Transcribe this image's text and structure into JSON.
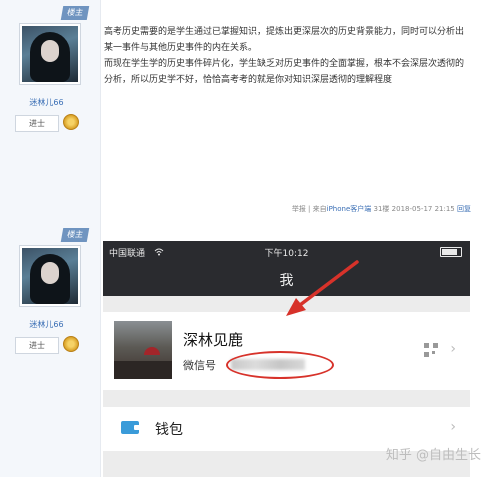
{
  "post1": {
    "corner_tag": "楼主",
    "username": "迷林儿66",
    "rank": "进士",
    "body_lines": [
      "高考历史需要的是学生通过已掌握知识，提炼出更深层次的历史背景能力，同时可以分析出",
      "某一事件与其他历史事件的内在关系。",
      "而现在学生学的历史事件碎片化，学生缺乏对历史事件的全面掌握，根本不会深层次透彻的",
      "分析，所以历史学不好，恰恰高考考的就是你对知识深层透彻的理解程度"
    ],
    "meta": {
      "report": "举报",
      "from_prefix": "来自",
      "from_device": "iPhone客户端",
      "floor": "31楼",
      "datetime": "2018-05-17 21:15",
      "reply": "回复"
    }
  },
  "post2": {
    "corner_tag": "楼主",
    "username": "迷林儿66",
    "rank": "进士"
  },
  "phone": {
    "carrier": "中国联通",
    "wifi_icon": "wifi-icon",
    "time": "下午10:12",
    "title": "我",
    "profile_name": "深林见鹿",
    "wechat_id_label": "微信号",
    "wallet_label": "钱包"
  },
  "watermark": "知乎 @自由生长",
  "colors": {
    "annotation_red": "#d7322a",
    "link_blue": "#3b6fb5"
  }
}
